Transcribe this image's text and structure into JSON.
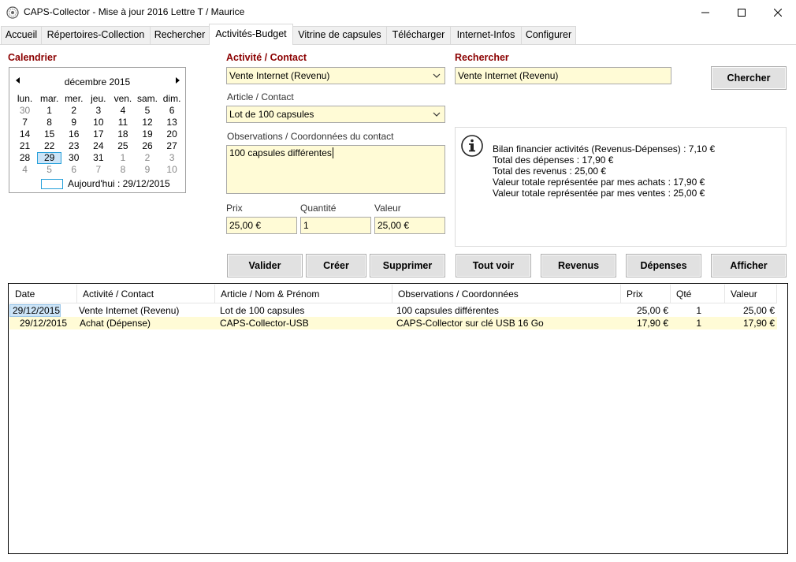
{
  "window": {
    "title": "CAPS-Collector - Mise à jour 2016 Lettre T / Maurice"
  },
  "tabs": [
    {
      "label": "Accueil"
    },
    {
      "label": "Répertoires-Collection"
    },
    {
      "label": "Rechercher"
    },
    {
      "label": "Activités-Budget",
      "active": true
    },
    {
      "label": "Vitrine de capsules"
    },
    {
      "label": "Télécharger"
    },
    {
      "label": "Internet-Infos"
    },
    {
      "label": "Configurer"
    }
  ],
  "calendar": {
    "section_label": "Calendrier",
    "month_label": "décembre 2015",
    "weekdays": [
      "lun.",
      "mar.",
      "mer.",
      "jeu.",
      "ven.",
      "sam.",
      "dim."
    ],
    "weeks": [
      [
        "30",
        "1",
        "2",
        "3",
        "4",
        "5",
        "6"
      ],
      [
        "7",
        "8",
        "9",
        "10",
        "11",
        "12",
        "13"
      ],
      [
        "14",
        "15",
        "16",
        "17",
        "18",
        "19",
        "20"
      ],
      [
        "21",
        "22",
        "23",
        "24",
        "25",
        "26",
        "27"
      ],
      [
        "28",
        "29",
        "30",
        "31",
        "1",
        "2",
        "3"
      ],
      [
        "4",
        "5",
        "6",
        "7",
        "8",
        "9",
        "10"
      ]
    ],
    "selected_day": "29",
    "today_label": "Aujourd'hui : 29/12/2015"
  },
  "form": {
    "activity_section": "Activité / Contact",
    "activity_value": "Vente Internet (Revenu)",
    "article_label": "Article / Contact",
    "article_value": "Lot de 100 capsules",
    "observations_label": "Observations / Coordonnées du contact",
    "observations_value": "100 capsules différentes",
    "price_label": "Prix",
    "price_value": "25,00 €",
    "quantity_label": "Quantité",
    "quantity_value": "1",
    "value_label": "Valeur",
    "value_value": "25,00 €"
  },
  "search": {
    "section_label": "Rechercher",
    "value": "Vente Internet (Revenu)",
    "button_label": "Chercher"
  },
  "summary": {
    "lines": [
      "Bilan financier activités (Revenus-Dépenses) : 7,10 €",
      "Total des dépenses : 17,90 €",
      "Total des revenus : 25,00 €",
      "Valeur totale représentée par mes achats : 17,90 €",
      "Valeur totale représentée par mes ventes : 25,00 €"
    ]
  },
  "buttons": {
    "validate": "Valider",
    "create": "Créer",
    "delete": "Supprimer",
    "show_all": "Tout voir",
    "revenues": "Revenus",
    "expenses": "Dépenses",
    "display": "Afficher"
  },
  "table": {
    "columns": [
      "Date",
      "Activité / Contact",
      "Article / Nom & Prénom",
      "Observations / Coordonnées",
      "Prix",
      "Qté",
      "Valeur"
    ],
    "rows": [
      [
        "29/12/2015",
        "Vente Internet (Revenu)",
        "Lot de 100 capsules",
        "100 capsules différentes",
        "25,00 €",
        "1",
        "25,00 €"
      ],
      [
        "29/12/2015",
        "Achat (Dépense)",
        "CAPS-Collector-USB",
        "CAPS-Collector sur clé USB 16 Go",
        "17,90 €",
        "1",
        "17,90 €"
      ]
    ]
  },
  "colors": {
    "field_background": "#fffbd6",
    "section_label": "#8b0000",
    "selected_date_cell": "#cce4f7"
  }
}
